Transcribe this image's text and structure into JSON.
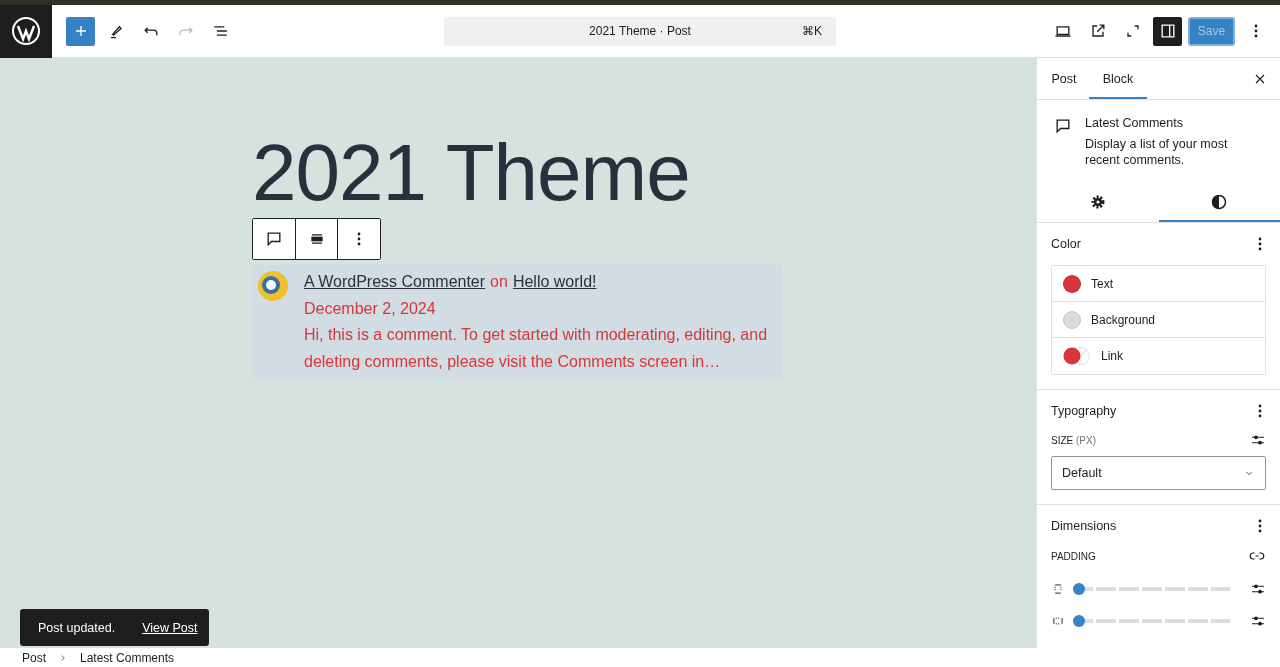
{
  "header": {
    "title": "2021 Theme · Post",
    "shortcut": "⌘K",
    "save": {
      "label": "Save",
      "disabled": true
    },
    "sidebar_toggle": {
      "on": true
    }
  },
  "canvas": {
    "title": "2021 Theme",
    "comment": {
      "author": "A WordPress Commenter",
      "joiner": "on",
      "post": "Hello world!",
      "date": "December 2, 2024",
      "excerpt": "Hi, this is a comment. To get started with moderating, editing, and deleting comments, please visit the Comments screen in…"
    }
  },
  "sidebar": {
    "tabs": [
      {
        "label": "Post",
        "selected": false
      },
      {
        "label": "Block",
        "selected": true
      }
    ],
    "block": {
      "title": "Latest Comments",
      "description": "Display a list of your most recent comments."
    },
    "icon_tabs": [
      {
        "kind": "settings",
        "selected": false
      },
      {
        "kind": "styles",
        "selected": true
      }
    ],
    "color": {
      "title": "Color",
      "items": [
        {
          "label": "Text",
          "kind": "solid",
          "color": "#d63638"
        },
        {
          "label": "Background",
          "kind": "solid",
          "color": "#d7dee2"
        },
        {
          "label": "Link",
          "kind": "split",
          "color": "#d63638"
        }
      ]
    },
    "typography": {
      "title": "Typography",
      "size_label": "SIZE",
      "unit": "(PX)",
      "value": "Default"
    },
    "dimensions": {
      "title": "Dimensions",
      "padding_label": "PADDING",
      "sliders": [
        {
          "kind": "vertical",
          "level": 0
        },
        {
          "kind": "horizontal",
          "level": 0
        }
      ]
    }
  },
  "notice": {
    "message": "Post updated.",
    "action": "View Post"
  },
  "breadcrumb": [
    "Post",
    "Latest Comments"
  ]
}
